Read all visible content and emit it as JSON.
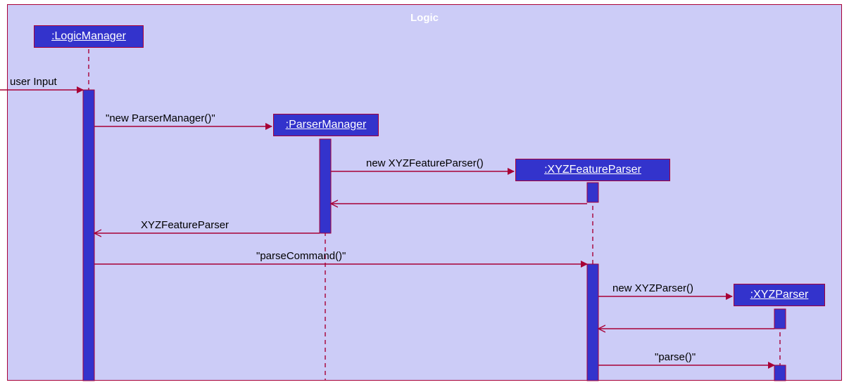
{
  "frame": {
    "title": "Logic"
  },
  "participants": {
    "logicManager": ":LogicManager",
    "parserManager": ":ParserManager",
    "xyzFeatureParser": ":XYZFeatureParser",
    "xyzParser": ":XYZParser"
  },
  "messages": {
    "userInput": "user Input",
    "newParserManager": "\"new ParserManager()\"",
    "newXYZFeatureParser": "new XYZFeatureParser()",
    "returnXYZFeatureParser": "XYZFeatureParser",
    "parseCommand": "\"parseCommand()\"",
    "newXYZParser": "new XYZParser()",
    "parse": "\"parse()\""
  },
  "layout": {
    "lifelines": {
      "logicManager": 126,
      "parserManager": 462,
      "xyzFeatureParser": 842,
      "xyzParser": 1108
    }
  }
}
